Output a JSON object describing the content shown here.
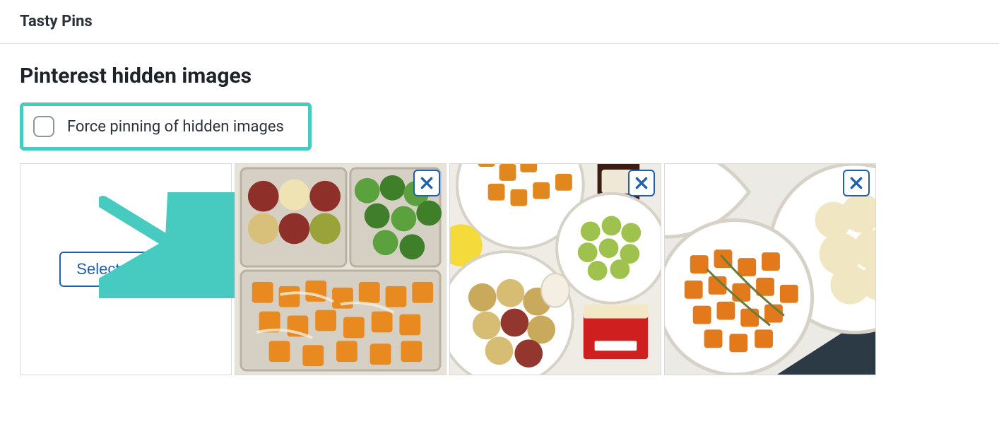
{
  "plugin": {
    "title": "Tasty Pins"
  },
  "section": {
    "title": "Pinterest hidden images"
  },
  "force_pin": {
    "label": "Force pinning of hidden images",
    "checked": false
  },
  "select_button": {
    "label": "Select Images"
  },
  "thumbnails": [
    {
      "name": "hidden-image-1"
    },
    {
      "name": "hidden-image-2"
    },
    {
      "name": "hidden-image-3"
    }
  ],
  "annotation": {
    "highlight_color": "#47cbc0"
  }
}
